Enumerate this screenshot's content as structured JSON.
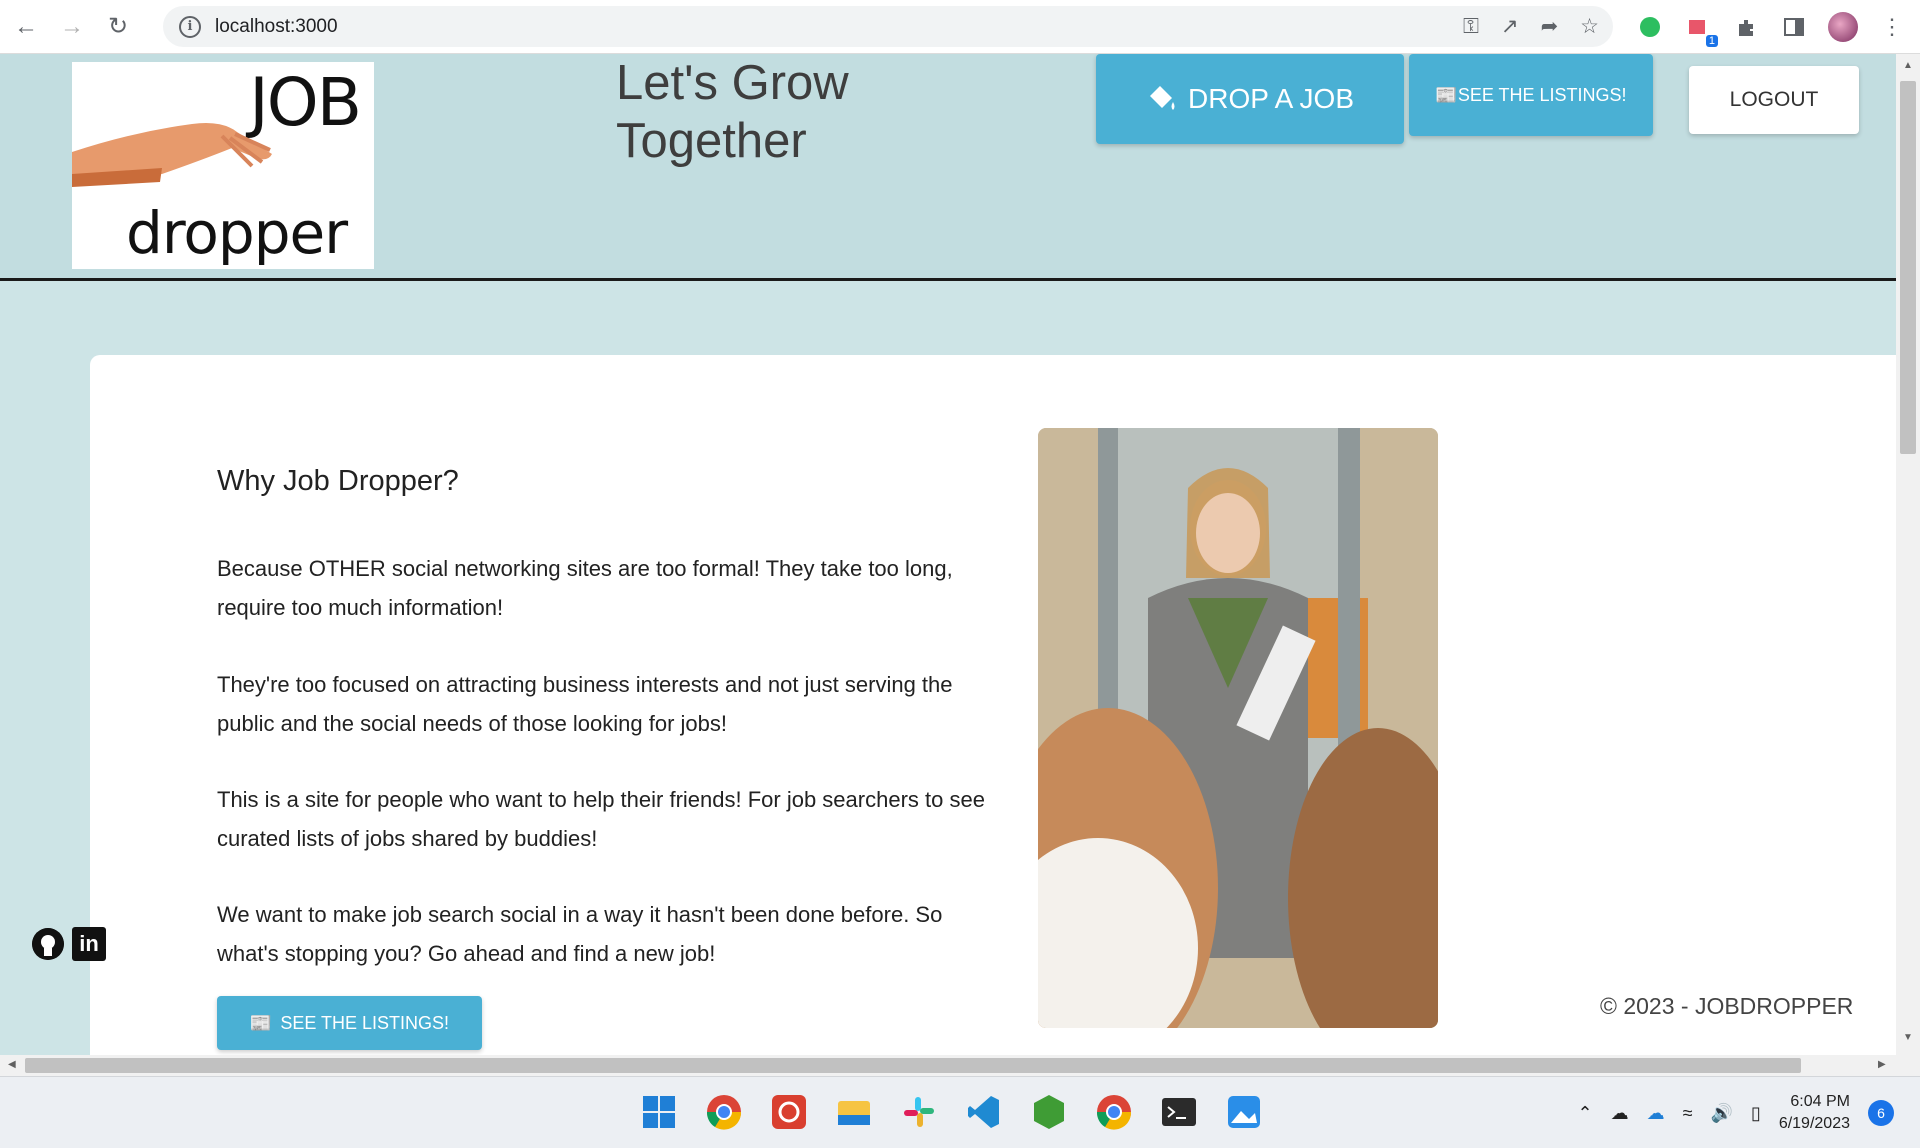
{
  "browser": {
    "url": "localhost:3000"
  },
  "header": {
    "logo_top": "JOB",
    "logo_bottom": "dropper",
    "tagline": "Let's Grow Together",
    "drop_job_label": "DROP A JOB",
    "see_listings_label": "SEE THE LISTINGS!",
    "logout_label": "LOGOUT"
  },
  "main": {
    "title": "Why Job Dropper?",
    "paragraphs": [
      "Because OTHER social networking sites are too formal! They take too long, require too much information!",
      "They're too focused on attracting business interests and not just serving the public and the social needs of those looking for jobs!",
      "This is a site for people who want to help their friends! For job searchers to see curated lists of jobs shared by buddies!",
      "We want to make job search social in a way it hasn't been done before. So what's stopping you? Go ahead and find a new job!"
    ],
    "see_listings_label": "SEE THE LISTINGS!",
    "copyright": "© 2023 - JOBDROPPER"
  },
  "social": {
    "linkedin_text": "in"
  },
  "taskbar": {
    "time": "6:04 PM",
    "date": "6/19/2023",
    "notifications": "6"
  },
  "colors": {
    "accent": "#4ab0d4",
    "header_bg": "#c2dde0",
    "page_bg": "#cde4e6"
  }
}
